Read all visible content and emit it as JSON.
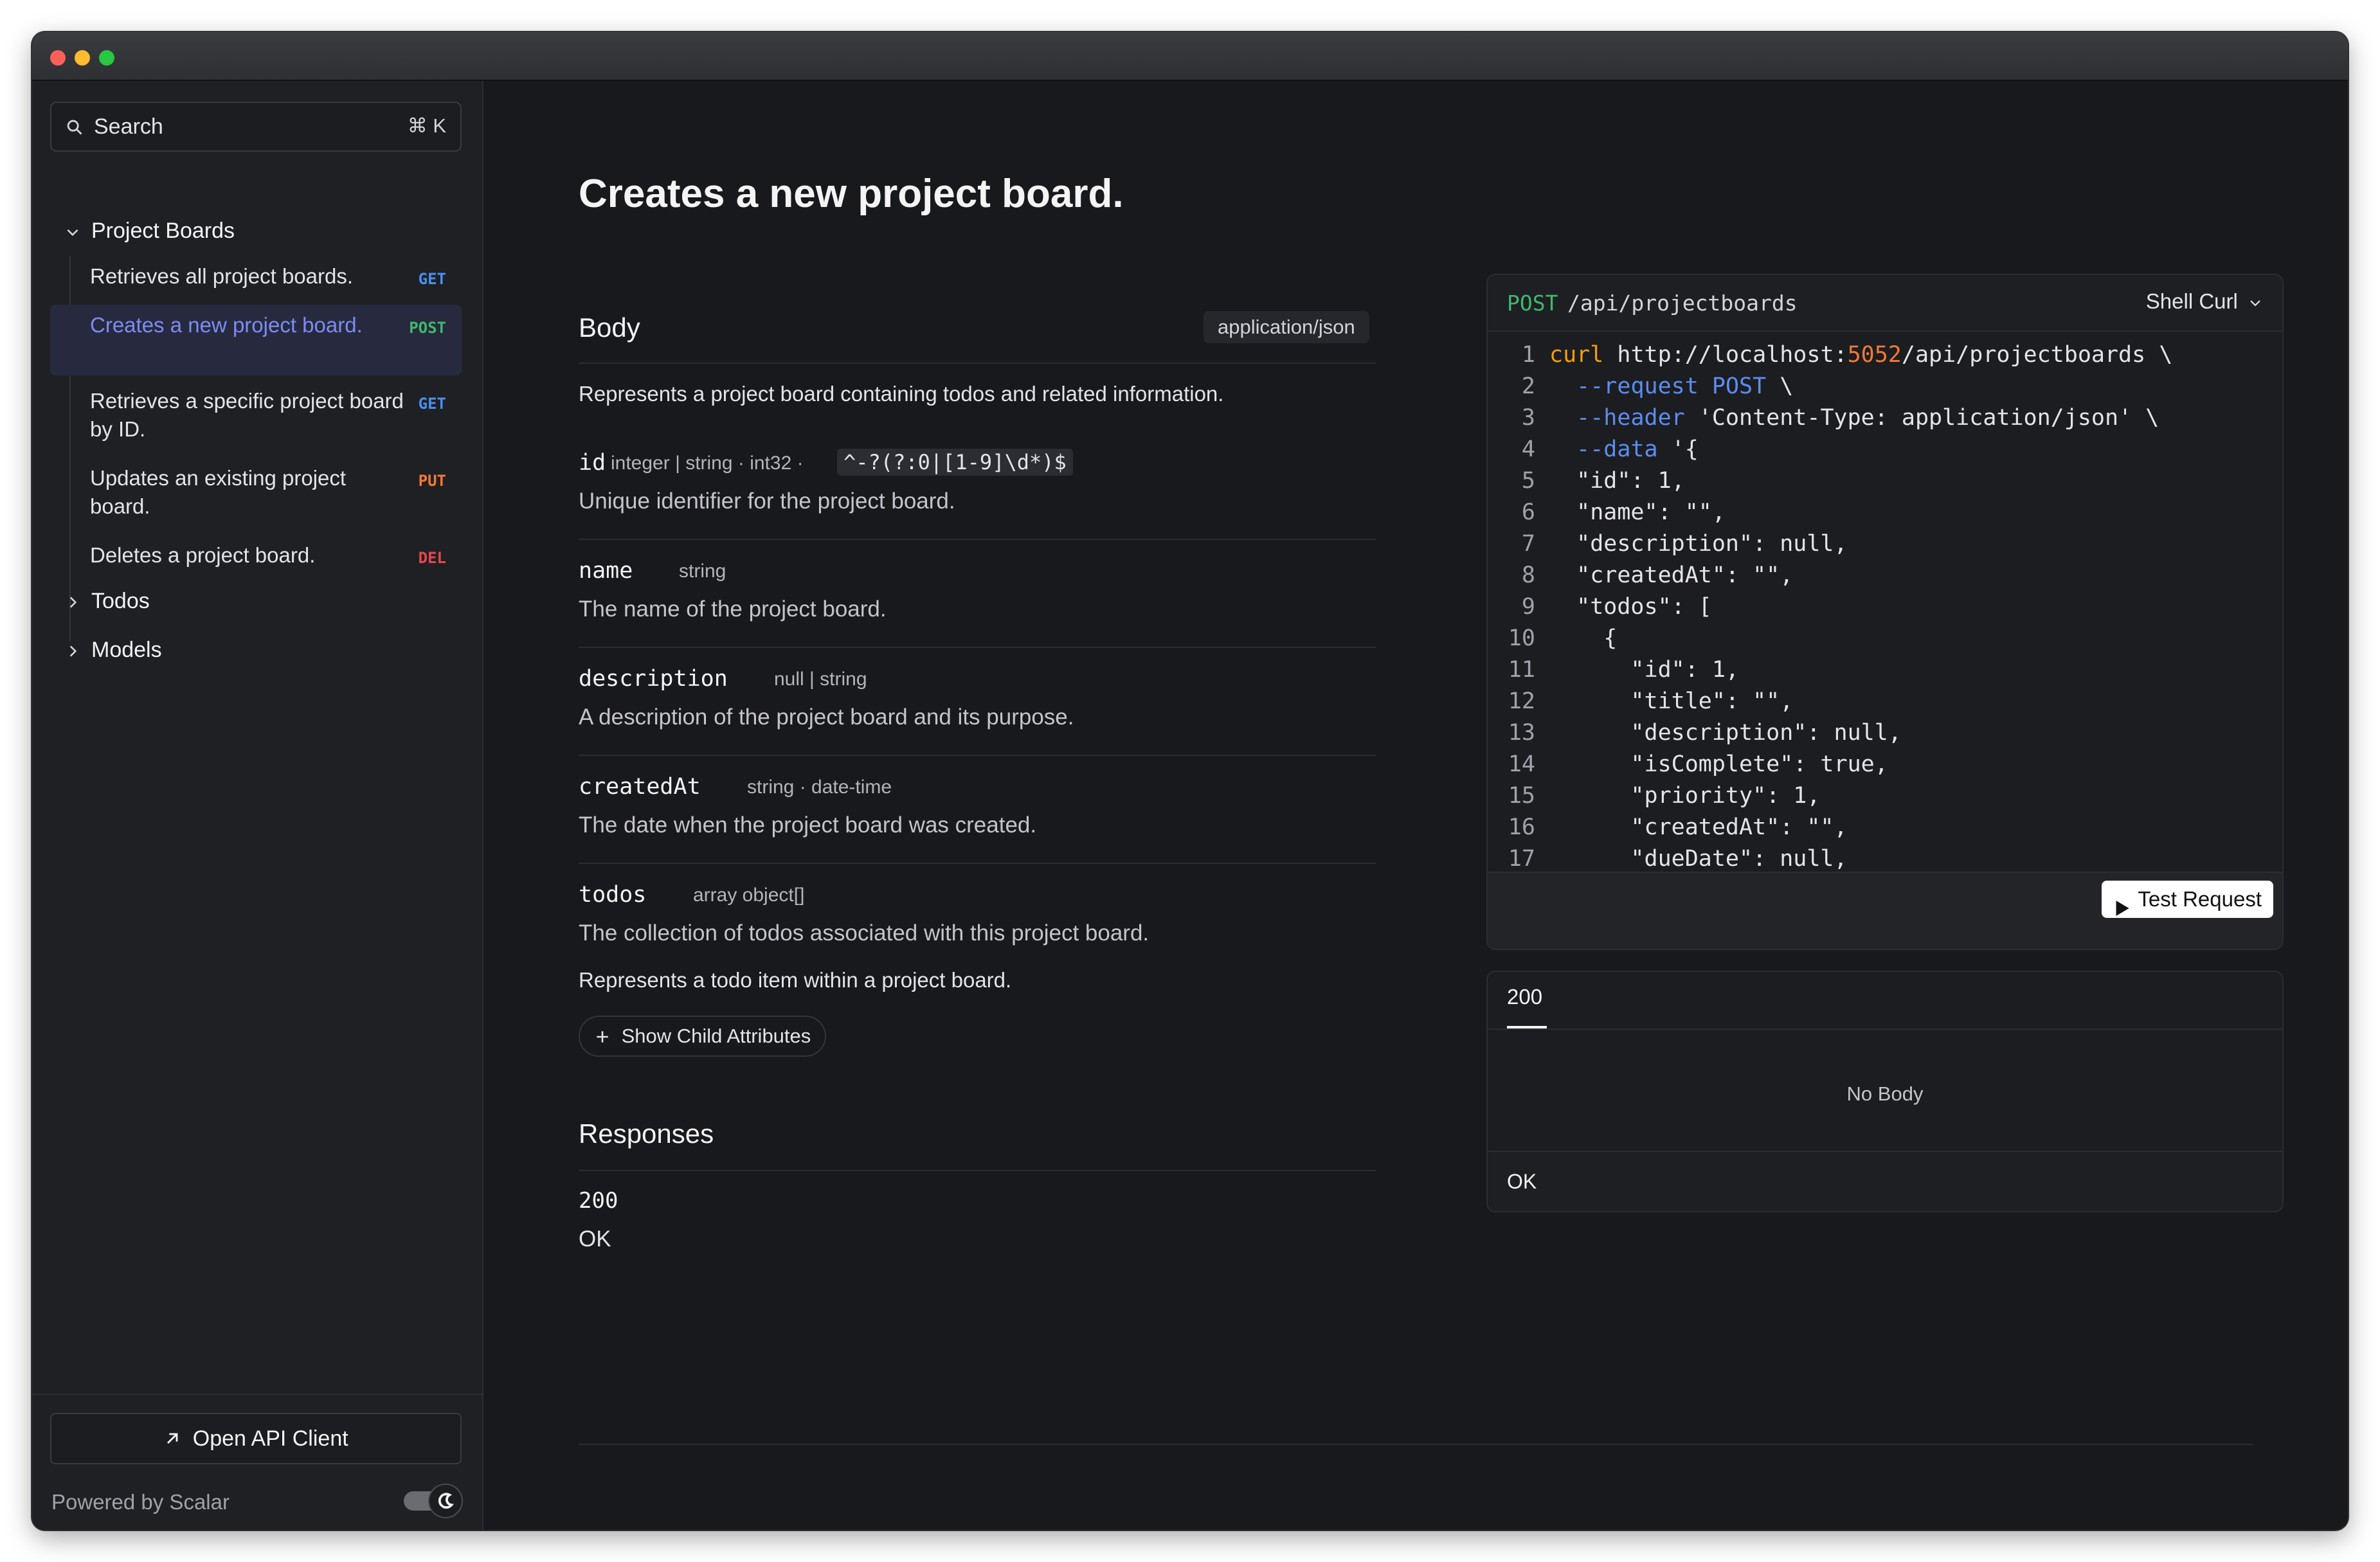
{
  "sidebar": {
    "search_label": "Search",
    "search_shortcut": "⌘ K",
    "groups": [
      {
        "label": "Project Boards",
        "expanded": true
      },
      {
        "label": "Todos",
        "expanded": false
      },
      {
        "label": "Models",
        "expanded": false
      }
    ],
    "items": [
      {
        "label": "Retrieves all project boards.",
        "method": "GET"
      },
      {
        "label": "Creates a new project board.",
        "method": "POST",
        "active": true
      },
      {
        "label": "Retrieves a specific project board by ID.",
        "method": "GET"
      },
      {
        "label": "Updates an existing project board.",
        "method": "PUT"
      },
      {
        "label": "Deletes a project board.",
        "method": "DEL"
      }
    ],
    "open_client_label": "Open API Client",
    "powered_by": "Powered by Scalar"
  },
  "main": {
    "title": "Creates a new project board.",
    "body_title": "Body",
    "content_type": "application/json",
    "body_description": "Represents a project board containing todos and related information.",
    "properties": [
      {
        "name": "id",
        "type": "integer | string · int32 ·",
        "pattern": "^-?(?:0|[1-9]\\d*)$",
        "description": "Unique identifier for the project board."
      },
      {
        "name": "name",
        "type": "string",
        "description": "The name of the project board."
      },
      {
        "name": "description",
        "type": "null | string",
        "description": "A description of the project board and its purpose."
      },
      {
        "name": "createdAt",
        "type": "string · date-time",
        "description": "The date when the project board was created."
      },
      {
        "name": "todos",
        "type": "array object[]",
        "description": "The collection of todos associated with this project board.",
        "item_description": "Represents a todo item within a project board."
      }
    ],
    "show_child_label": "Show Child Attributes",
    "responses_title": "Responses",
    "response_code": "200",
    "response_text": "OK"
  },
  "code": {
    "method": "POST",
    "path": "/api/projectboards",
    "language": "Shell Curl",
    "test_label": "Test Request",
    "lines": [
      "curl http://localhost:5052/api/projectboards \\",
      "  --request POST \\",
      "  --header 'Content-Type: application/json' \\",
      "  --data '{",
      "  \"id\": 1,",
      "  \"name\": \"\",",
      "  \"description\": null,",
      "  \"createdAt\": \"\",",
      "  \"todos\": [",
      "    {",
      "      \"id\": 1,",
      "      \"title\": \"\",",
      "      \"description\": null,",
      "      \"isComplete\": true,",
      "      \"priority\": 1,",
      "      \"createdAt\": \"\",",
      "      \"dueDate\": null,"
    ]
  },
  "response_panel": {
    "tab_label": "200",
    "empty_label": "No Body",
    "footer_label": "OK"
  },
  "colors": {
    "get": "#4a8ff0",
    "post": "#3fb969",
    "put": "#f07a38",
    "del": "#e5484d",
    "active_text": "#7c8cf2"
  }
}
